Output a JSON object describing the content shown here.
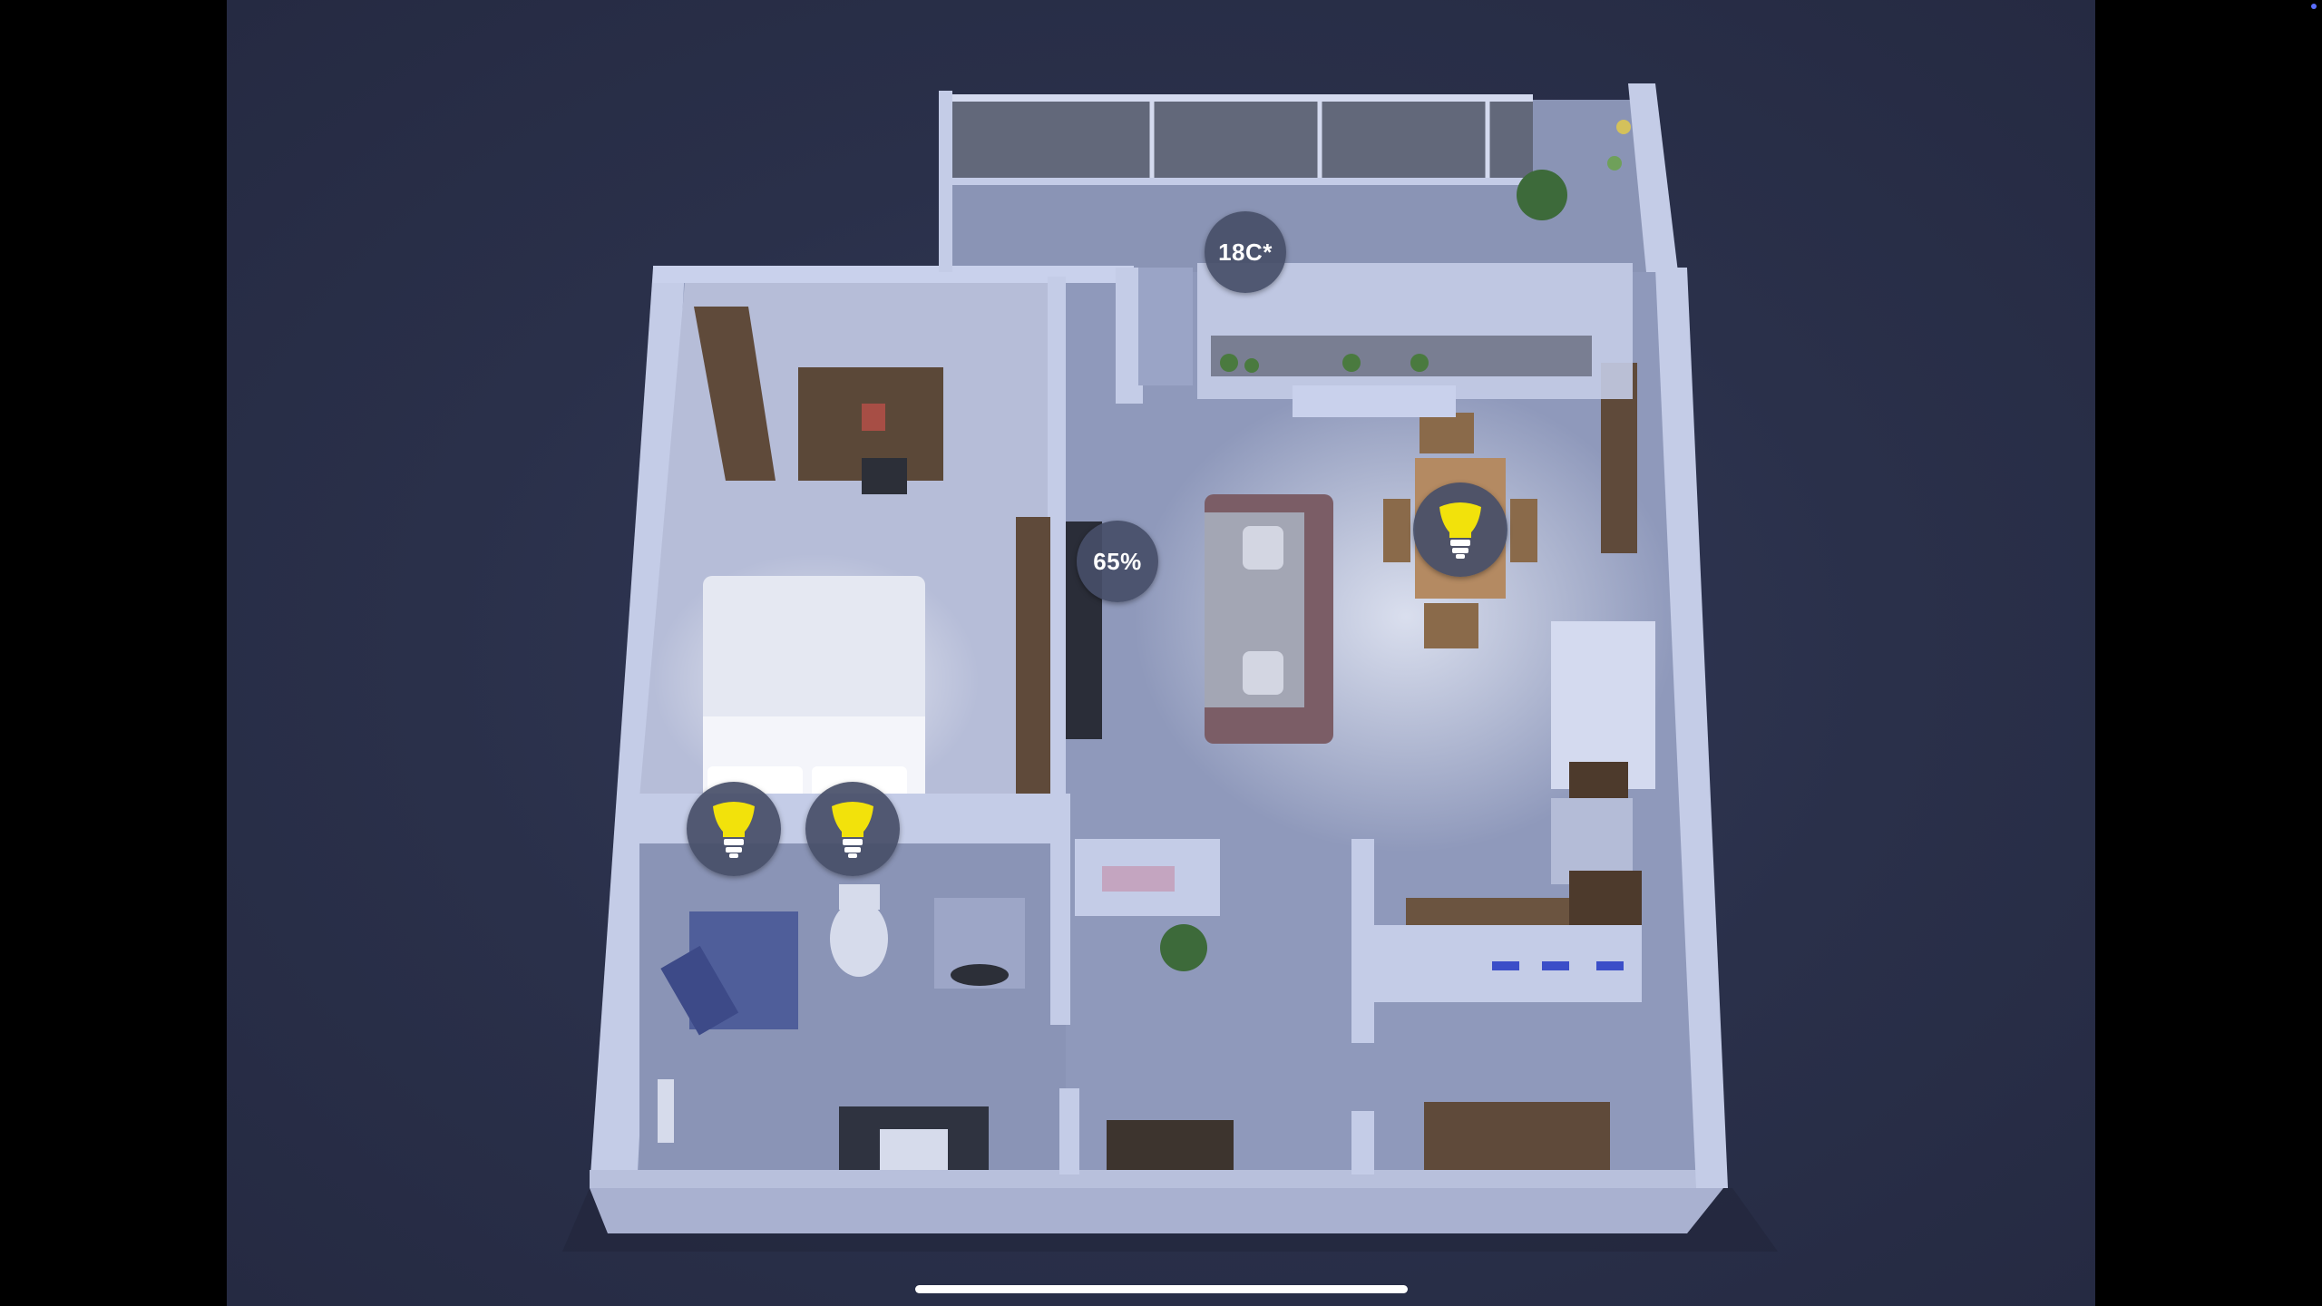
{
  "floorplan": {
    "sensors": {
      "temperature_label": "18C*",
      "humidity_label": "65%"
    },
    "lights": [
      {
        "room": "dining",
        "icon": "lightbulb-icon",
        "state": "on"
      },
      {
        "room": "bedroom",
        "icon": "lightbulb-icon",
        "state": "on"
      },
      {
        "room": "bedroom",
        "icon": "lightbulb-icon",
        "state": "on"
      }
    ]
  },
  "colors": {
    "background": "#2a304a",
    "wall": "#c3cbe6",
    "floor": "#8e98ba",
    "badge": "#464e68",
    "bulb_on": "#f2e20b"
  }
}
